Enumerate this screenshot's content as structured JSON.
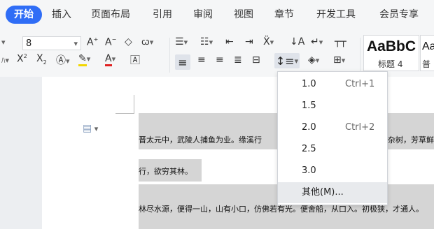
{
  "menu": {
    "tabs": [
      "开始",
      "插入",
      "页面布局",
      "引用",
      "审阅",
      "视图",
      "章节",
      "开发工具",
      "会员专享"
    ]
  },
  "ribbon": {
    "font_size": "8",
    "styles": [
      {
        "sample": "AaBbC",
        "label": "标题 4"
      },
      {
        "sample": "Aa",
        "label": "普"
      }
    ]
  },
  "line_spacing_menu": {
    "items": [
      {
        "label": "1.0",
        "shortcut": "Ctrl+1"
      },
      {
        "label": "1.5",
        "shortcut": ""
      },
      {
        "label": "2.0",
        "shortcut": "Ctrl+2"
      },
      {
        "label": "2.5",
        "shortcut": ""
      },
      {
        "label": "3.0",
        "shortcut": ""
      },
      {
        "label": "其他(M)...",
        "shortcut": ""
      }
    ]
  },
  "document": {
    "lines": [
      "晋太元中，武陵人捕鱼为业。缘溪行",
      "杂树，芳草鲜",
      "行，欲穷其林。",
      "林尽水源，便得一山，山有小口，仿佛若有光。便舍船，从口入。初极狭，才通人。"
    ]
  }
}
